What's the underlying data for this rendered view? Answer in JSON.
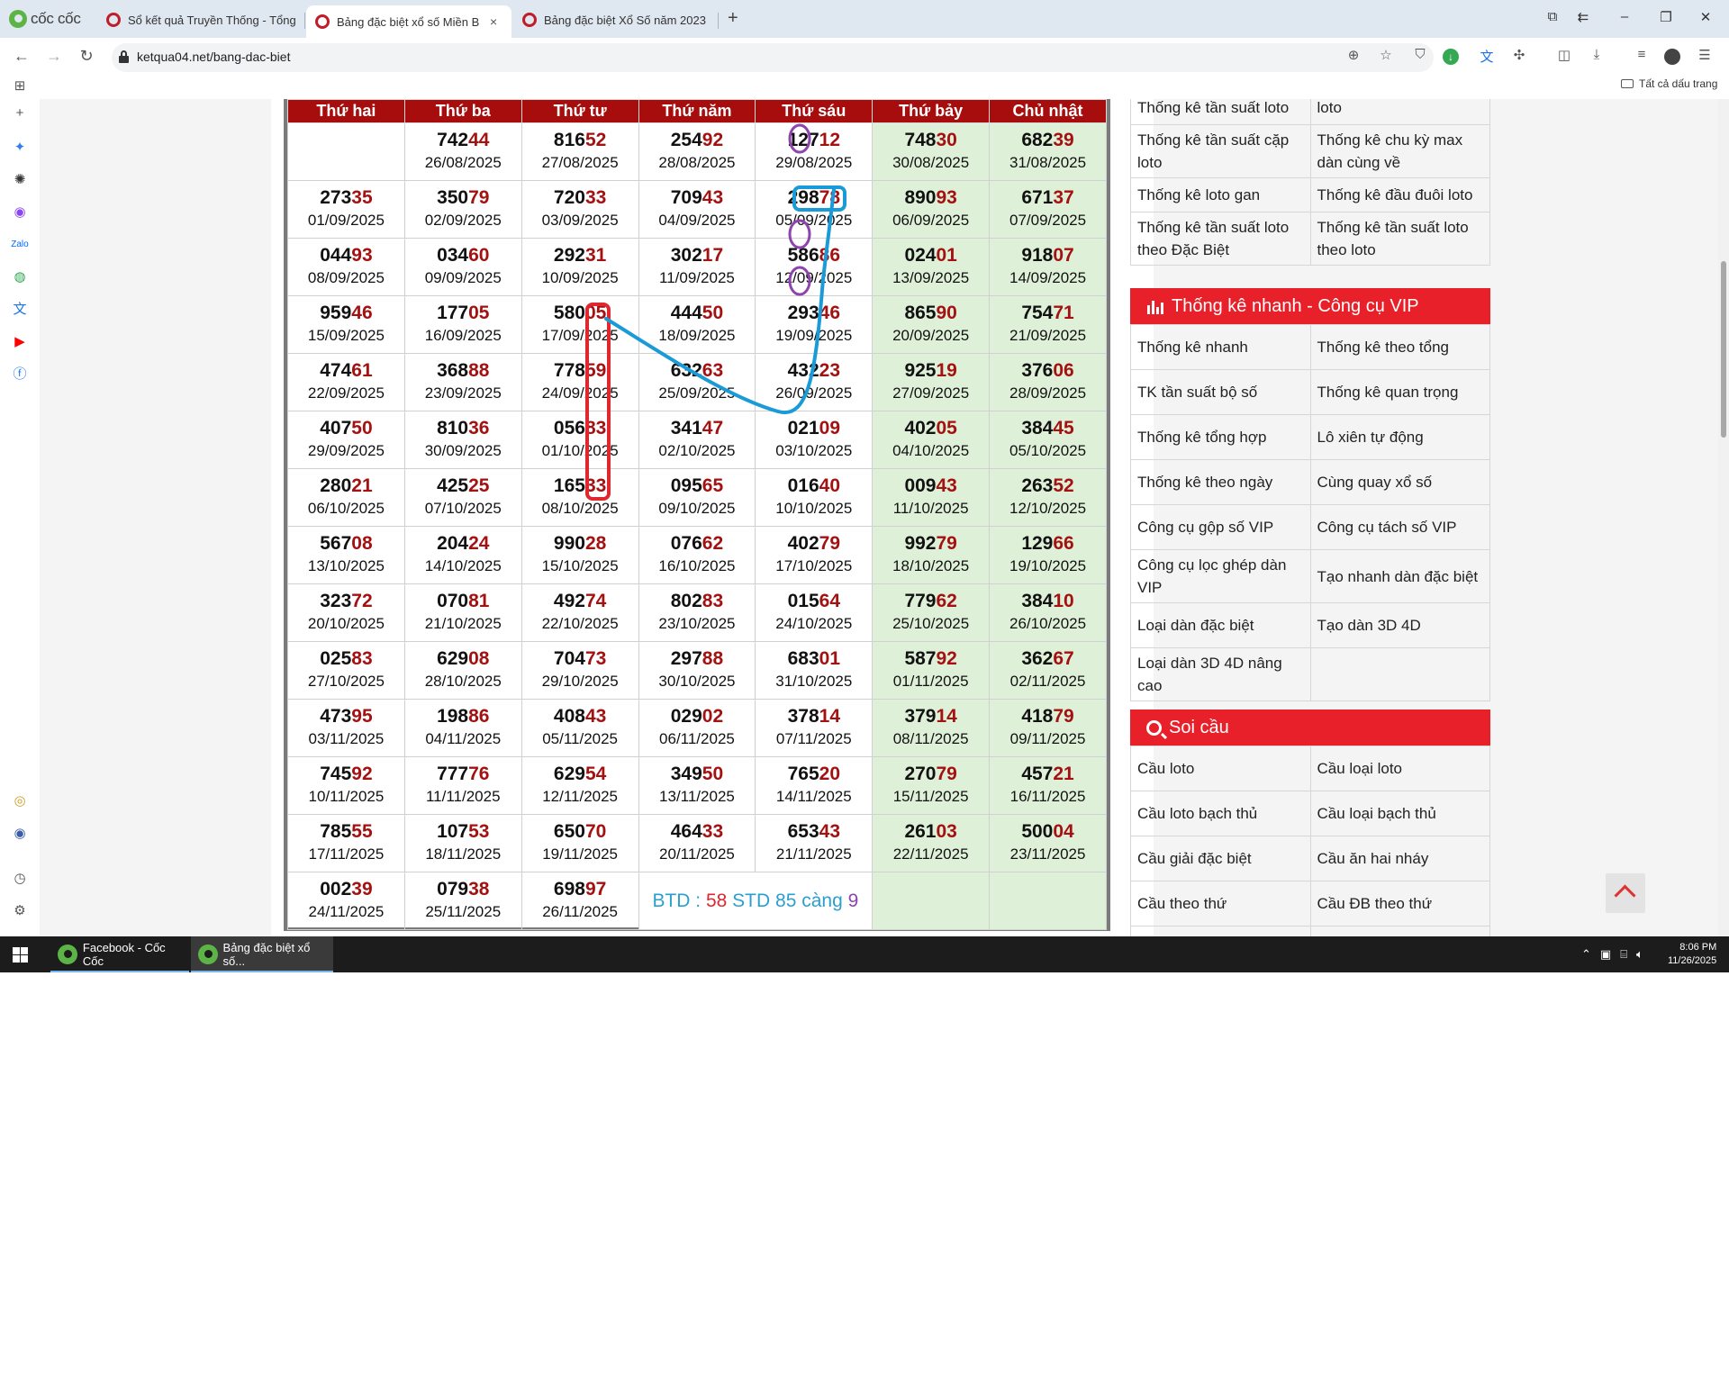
{
  "browser": {
    "logo_text": "cốc cốc",
    "tabs": [
      {
        "label": "Sổ kết quả Truyền Thống - Tổng",
        "active": false
      },
      {
        "label": "Bảng đặc biệt xổ số Miền B",
        "active": true
      },
      {
        "label": "Bảng đặc biệt Xổ Số năm 2023",
        "active": false
      }
    ],
    "newtab_glyph": "+",
    "close_glyph": "×",
    "url": "ketqua04.net/bang-dac-biet",
    "bookmarks_label": "Tất cả dấu trang"
  },
  "lotto": {
    "headers": [
      "Thứ hai",
      "Thứ ba",
      "Thứ tư",
      "Thứ năm",
      "Thứ sáu",
      "Thứ bảy",
      "Chủ nhật"
    ],
    "rows": [
      [
        null,
        {
          "head": "742",
          "tail": "44",
          "date": "26/08/2025"
        },
        {
          "head": "816",
          "tail": "52",
          "date": "27/08/2025"
        },
        {
          "head": "254",
          "tail": "92",
          "date": "28/08/2025"
        },
        {
          "head": "127",
          "tail": "12",
          "date": "29/08/2025"
        },
        {
          "head": "748",
          "tail": "30",
          "date": "30/08/2025"
        },
        {
          "head": "682",
          "tail": "39",
          "date": "31/08/2025"
        }
      ],
      [
        {
          "head": "273",
          "tail": "35",
          "date": "01/09/2025"
        },
        {
          "head": "350",
          "tail": "79",
          "date": "02/09/2025"
        },
        {
          "head": "720",
          "tail": "33",
          "date": "03/09/2025"
        },
        {
          "head": "709",
          "tail": "43",
          "date": "04/09/2025"
        },
        {
          "head": "298",
          "tail": "78",
          "date": "05/09/2025"
        },
        {
          "head": "890",
          "tail": "93",
          "date": "06/09/2025"
        },
        {
          "head": "671",
          "tail": "37",
          "date": "07/09/2025"
        }
      ],
      [
        {
          "head": "044",
          "tail": "93",
          "date": "08/09/2025"
        },
        {
          "head": "034",
          "tail": "60",
          "date": "09/09/2025"
        },
        {
          "head": "292",
          "tail": "31",
          "date": "10/09/2025"
        },
        {
          "head": "302",
          "tail": "17",
          "date": "11/09/2025"
        },
        {
          "head": "586",
          "tail": "86",
          "date": "12/09/2025"
        },
        {
          "head": "024",
          "tail": "01",
          "date": "13/09/2025"
        },
        {
          "head": "918",
          "tail": "07",
          "date": "14/09/2025"
        }
      ],
      [
        {
          "head": "959",
          "tail": "46",
          "date": "15/09/2025"
        },
        {
          "head": "177",
          "tail": "05",
          "date": "16/09/2025"
        },
        {
          "head": "580",
          "tail": "05",
          "date": "17/09/2025"
        },
        {
          "head": "444",
          "tail": "50",
          "date": "18/09/2025"
        },
        {
          "head": "293",
          "tail": "46",
          "date": "19/09/2025"
        },
        {
          "head": "865",
          "tail": "90",
          "date": "20/09/2025"
        },
        {
          "head": "754",
          "tail": "71",
          "date": "21/09/2025"
        }
      ],
      [
        {
          "head": "474",
          "tail": "61",
          "date": "22/09/2025"
        },
        {
          "head": "368",
          "tail": "88",
          "date": "23/09/2025"
        },
        {
          "head": "778",
          "tail": "59",
          "date": "24/09/2025"
        },
        {
          "head": "632",
          "tail": "63",
          "date": "25/09/2025"
        },
        {
          "head": "432",
          "tail": "23",
          "date": "26/09/2025"
        },
        {
          "head": "925",
          "tail": "19",
          "date": "27/09/2025"
        },
        {
          "head": "376",
          "tail": "06",
          "date": "28/09/2025"
        }
      ],
      [
        {
          "head": "407",
          "tail": "50",
          "date": "29/09/2025"
        },
        {
          "head": "810",
          "tail": "36",
          "date": "30/09/2025"
        },
        {
          "head": "056",
          "tail": "83",
          "date": "01/10/2025"
        },
        {
          "head": "341",
          "tail": "47",
          "date": "02/10/2025"
        },
        {
          "head": "021",
          "tail": "09",
          "date": "03/10/2025"
        },
        {
          "head": "402",
          "tail": "05",
          "date": "04/10/2025"
        },
        {
          "head": "384",
          "tail": "45",
          "date": "05/10/2025"
        }
      ],
      [
        {
          "head": "280",
          "tail": "21",
          "date": "06/10/2025"
        },
        {
          "head": "425",
          "tail": "25",
          "date": "07/10/2025"
        },
        {
          "head": "165",
          "tail": "33",
          "date": "08/10/2025"
        },
        {
          "head": "095",
          "tail": "65",
          "date": "09/10/2025"
        },
        {
          "head": "016",
          "tail": "40",
          "date": "10/10/2025"
        },
        {
          "head": "009",
          "tail": "43",
          "date": "11/10/2025"
        },
        {
          "head": "263",
          "tail": "52",
          "date": "12/10/2025"
        }
      ],
      [
        {
          "head": "567",
          "tail": "08",
          "date": "13/10/2025"
        },
        {
          "head": "204",
          "tail": "24",
          "date": "14/10/2025"
        },
        {
          "head": "990",
          "tail": "28",
          "date": "15/10/2025"
        },
        {
          "head": "076",
          "tail": "62",
          "date": "16/10/2025"
        },
        {
          "head": "402",
          "tail": "79",
          "date": "17/10/2025"
        },
        {
          "head": "992",
          "tail": "79",
          "date": "18/10/2025"
        },
        {
          "head": "129",
          "tail": "66",
          "date": "19/10/2025"
        }
      ],
      [
        {
          "head": "323",
          "tail": "72",
          "date": "20/10/2025"
        },
        {
          "head": "070",
          "tail": "81",
          "date": "21/10/2025"
        },
        {
          "head": "492",
          "tail": "74",
          "date": "22/10/2025"
        },
        {
          "head": "802",
          "tail": "83",
          "date": "23/10/2025"
        },
        {
          "head": "015",
          "tail": "64",
          "date": "24/10/2025"
        },
        {
          "head": "779",
          "tail": "62",
          "date": "25/10/2025"
        },
        {
          "head": "384",
          "tail": "10",
          "date": "26/10/2025"
        }
      ],
      [
        {
          "head": "025",
          "tail": "83",
          "date": "27/10/2025"
        },
        {
          "head": "629",
          "tail": "08",
          "date": "28/10/2025"
        },
        {
          "head": "704",
          "tail": "73",
          "date": "29/10/2025"
        },
        {
          "head": "297",
          "tail": "88",
          "date": "30/10/2025"
        },
        {
          "head": "683",
          "tail": "01",
          "date": "31/10/2025"
        },
        {
          "head": "587",
          "tail": "92",
          "date": "01/11/2025"
        },
        {
          "head": "362",
          "tail": "67",
          "date": "02/11/2025"
        }
      ],
      [
        {
          "head": "473",
          "tail": "95",
          "date": "03/11/2025"
        },
        {
          "head": "198",
          "tail": "86",
          "date": "04/11/2025"
        },
        {
          "head": "408",
          "tail": "43",
          "date": "05/11/2025"
        },
        {
          "head": "029",
          "tail": "02",
          "date": "06/11/2025"
        },
        {
          "head": "378",
          "tail": "14",
          "date": "07/11/2025"
        },
        {
          "head": "379",
          "tail": "14",
          "date": "08/11/2025"
        },
        {
          "head": "418",
          "tail": "79",
          "date": "09/11/2025"
        }
      ],
      [
        {
          "head": "745",
          "tail": "92",
          "date": "10/11/2025"
        },
        {
          "head": "777",
          "tail": "76",
          "date": "11/11/2025"
        },
        {
          "head": "629",
          "tail": "54",
          "date": "12/11/2025"
        },
        {
          "head": "349",
          "tail": "50",
          "date": "13/11/2025"
        },
        {
          "head": "765",
          "tail": "20",
          "date": "14/11/2025"
        },
        {
          "head": "270",
          "tail": "79",
          "date": "15/11/2025"
        },
        {
          "head": "457",
          "tail": "21",
          "date": "16/11/2025"
        }
      ],
      [
        {
          "head": "785",
          "tail": "55",
          "date": "17/11/2025"
        },
        {
          "head": "107",
          "tail": "53",
          "date": "18/11/2025"
        },
        {
          "head": "650",
          "tail": "70",
          "date": "19/11/2025"
        },
        {
          "head": "464",
          "tail": "33",
          "date": "20/11/2025"
        },
        {
          "head": "653",
          "tail": "43",
          "date": "21/11/2025"
        },
        {
          "head": "261",
          "tail": "03",
          "date": "22/11/2025"
        },
        {
          "head": "500",
          "tail": "04",
          "date": "23/11/2025"
        }
      ],
      [
        {
          "head": "002",
          "tail": "39",
          "date": "24/11/2025"
        },
        {
          "head": "079",
          "tail": "38",
          "date": "25/11/2025"
        },
        {
          "head": "698",
          "tail": "97",
          "date": "26/11/2025"
        },
        "BTD",
        null,
        null,
        null
      ]
    ],
    "btd": {
      "parts": [
        {
          "text": "BTD : ",
          "color": "#2a9fd0"
        },
        {
          "text": "58",
          "color": "#e0262e"
        },
        {
          "text": " STD 85 càng ",
          "color": "#2a9fd0"
        },
        {
          "text": "9",
          "color": "#8e44ad"
        }
      ]
    }
  },
  "rightpanel": {
    "top_table": [
      [
        "Thống kê tần suất loto",
        "loto"
      ],
      [
        "Thống kê tần suất cặp loto",
        "Thống kê chu kỳ max dàn cùng về"
      ],
      [
        "Thống kê loto gan",
        "Thống kê đầu đuôi loto"
      ],
      [
        "Thống kê tần suất loto theo Đặc Biệt",
        "Thống kê tần suất loto theo loto"
      ]
    ],
    "vip_title": "Thống kê nhanh - Công cụ VIP",
    "vip_table": [
      [
        "Thống kê nhanh",
        "Thống kê theo tổng"
      ],
      [
        "TK tần suất bộ số",
        "Thống kê quan trọng"
      ],
      [
        "Thống kê tổng hợp",
        "Lô xiên tự động"
      ],
      [
        "Thống kê theo ngày",
        "Cùng quay xổ số"
      ],
      [
        "Công cụ gộp số VIP",
        "Công cụ tách số VIP"
      ],
      [
        "Công cụ lọc ghép dàn VIP",
        "Tạo nhanh dàn đặc biệt"
      ],
      [
        "Loại dàn đặc biệt",
        "Tạo dàn 3D 4D"
      ],
      [
        "Loại dàn 3D 4D nâng cao",
        ""
      ]
    ],
    "soi_title": "Soi cầu",
    "soi_table": [
      [
        "Cầu loto",
        "Cầu loại loto"
      ],
      [
        "Cầu loto bạch thủ",
        "Cầu loại bạch thủ"
      ],
      [
        "Cầu giải đặc biệt",
        "Cầu ăn hai nháy"
      ],
      [
        "Cầu theo thứ",
        "Cầu ĐB theo thứ"
      ],
      [
        "",
        ""
      ]
    ]
  },
  "taskbar": {
    "apps": [
      {
        "label": "Facebook - Cốc Cốc"
      },
      {
        "label": "Bảng đặc biệt xổ số..."
      }
    ],
    "time": "8:06 PM",
    "date": "11/26/2025"
  },
  "colors": {
    "header_red": "#a80d0d",
    "tail_red": "#a31111",
    "weekend_green": "#dff0d8",
    "panel_red": "#e8202a",
    "annotation_red": "#e0262e",
    "annotation_blue": "#2a9fd0",
    "annotation_purple": "#8e44ad"
  }
}
